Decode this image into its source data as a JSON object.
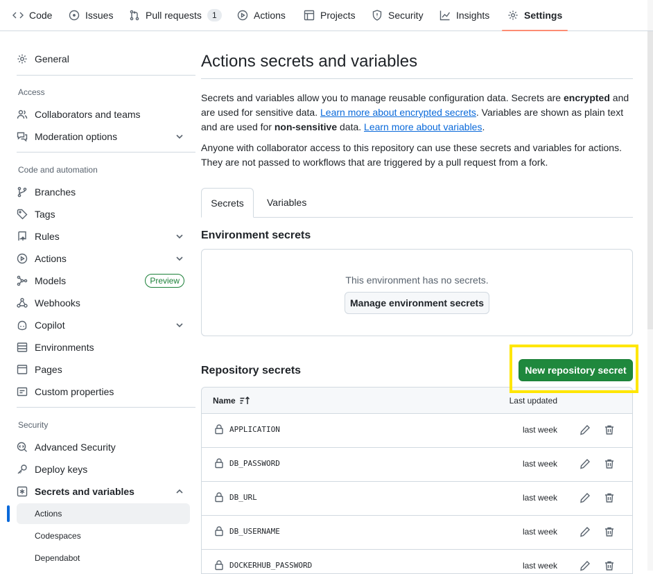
{
  "topnav": {
    "tabs": [
      {
        "label": "Code",
        "icon": "code-icon"
      },
      {
        "label": "Issues",
        "icon": "issue-icon"
      },
      {
        "label": "Pull requests",
        "icon": "pull-request-icon",
        "count": "1"
      },
      {
        "label": "Actions",
        "icon": "play-icon"
      },
      {
        "label": "Projects",
        "icon": "table-icon"
      },
      {
        "label": "Security",
        "icon": "shield-icon"
      },
      {
        "label": "Insights",
        "icon": "graph-icon"
      },
      {
        "label": "Settings",
        "icon": "gear-icon",
        "active": true
      }
    ]
  },
  "sidebar": {
    "general": "General",
    "access_heading": "Access",
    "collaborators": "Collaborators and teams",
    "moderation": "Moderation options",
    "code_heading": "Code and automation",
    "branches": "Branches",
    "tags": "Tags",
    "rules": "Rules",
    "actions": "Actions",
    "models": "Models",
    "models_badge": "Preview",
    "webhooks": "Webhooks",
    "copilot": "Copilot",
    "environments": "Environments",
    "pages": "Pages",
    "custom_properties": "Custom properties",
    "security_heading": "Security",
    "advanced_security": "Advanced Security",
    "deploy_keys": "Deploy keys",
    "secrets_variables": "Secrets and variables",
    "sub_actions": "Actions",
    "sub_codespaces": "Codespaces",
    "sub_dependabot": "Dependabot"
  },
  "main": {
    "title": "Actions secrets and variables",
    "intro_1": "Secrets and variables allow you to manage reusable configuration data. Secrets are ",
    "intro_bold_1": "encrypted",
    "intro_2": " and are used for sensitive data. ",
    "intro_link_1": "Learn more about encrypted secrets",
    "intro_3": ". Variables are shown as plain text and are used for ",
    "intro_bold_2": "non-sensitive",
    "intro_4": " data. ",
    "intro_link_2": "Learn more about variables",
    "intro_5": ".",
    "access_note": "Anyone with collaborator access to this repository can use these secrets and variables for actions. They are not passed to workflows that are triggered by a pull request from a fork.",
    "tab_secrets": "Secrets",
    "tab_variables": "Variables",
    "env_heading": "Environment secrets",
    "env_empty": "This environment has no secrets.",
    "env_manage_button": "Manage environment secrets",
    "repo_heading": "Repository secrets",
    "new_secret_button": "New repository secret",
    "col_name": "Name",
    "col_updated": "Last updated",
    "secrets": [
      {
        "name": "APPLICATION",
        "updated": "last week"
      },
      {
        "name": "DB_PASSWORD",
        "updated": "last week"
      },
      {
        "name": "DB_URL",
        "updated": "last week"
      },
      {
        "name": "DB_USERNAME",
        "updated": "last week"
      },
      {
        "name": "DOCKERHUB_PASSWORD",
        "updated": "last week"
      }
    ]
  },
  "colors": {
    "accent": "#0969da",
    "primary_button": "#1f883d",
    "highlight": "#ffe600",
    "active_tab_underline": "#fd8c73"
  }
}
